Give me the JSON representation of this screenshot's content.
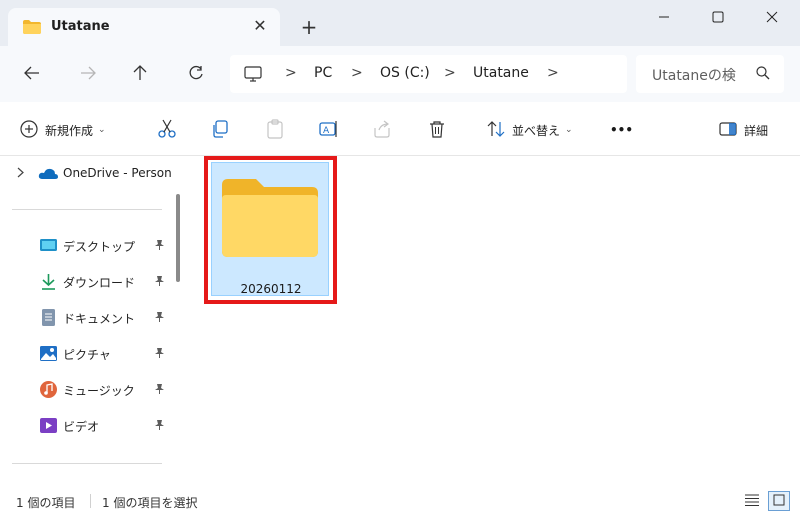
{
  "window": {
    "tab_title": "Utatane",
    "tab_close": "✕",
    "new_tab": "+",
    "icons": {
      "folder": "folder-icon",
      "minimize": "minimize-icon",
      "maximize": "maximize-icon",
      "close": "close-icon"
    }
  },
  "nav": {
    "breadcrumbs": [
      "PC",
      "OS (C:)",
      "Utatane"
    ],
    "separator": ">",
    "search_placeholder": "Utataneの検"
  },
  "toolbar": {
    "new_label": "新規作成",
    "sort_label": "並べ替え",
    "details_label": "詳細",
    "more": "•••"
  },
  "sidebar": {
    "onedrive": "OneDrive - Person",
    "items": [
      {
        "label": "デスクトップ",
        "icon": "desktop-icon"
      },
      {
        "label": "ダウンロード",
        "icon": "download-icon"
      },
      {
        "label": "ドキュメント",
        "icon": "documents-icon"
      },
      {
        "label": "ピクチャ",
        "icon": "pictures-icon"
      },
      {
        "label": "ミュージック",
        "icon": "music-icon"
      },
      {
        "label": "ビデオ",
        "icon": "videos-icon"
      }
    ]
  },
  "content": {
    "folder_name": "20260112",
    "highlight_color": "#e51919"
  },
  "status": {
    "item_count": "1 個の項目",
    "selected": "1 個の項目を選択"
  },
  "colors": {
    "selection": "#cce8ff",
    "accent": "#0067c0"
  }
}
